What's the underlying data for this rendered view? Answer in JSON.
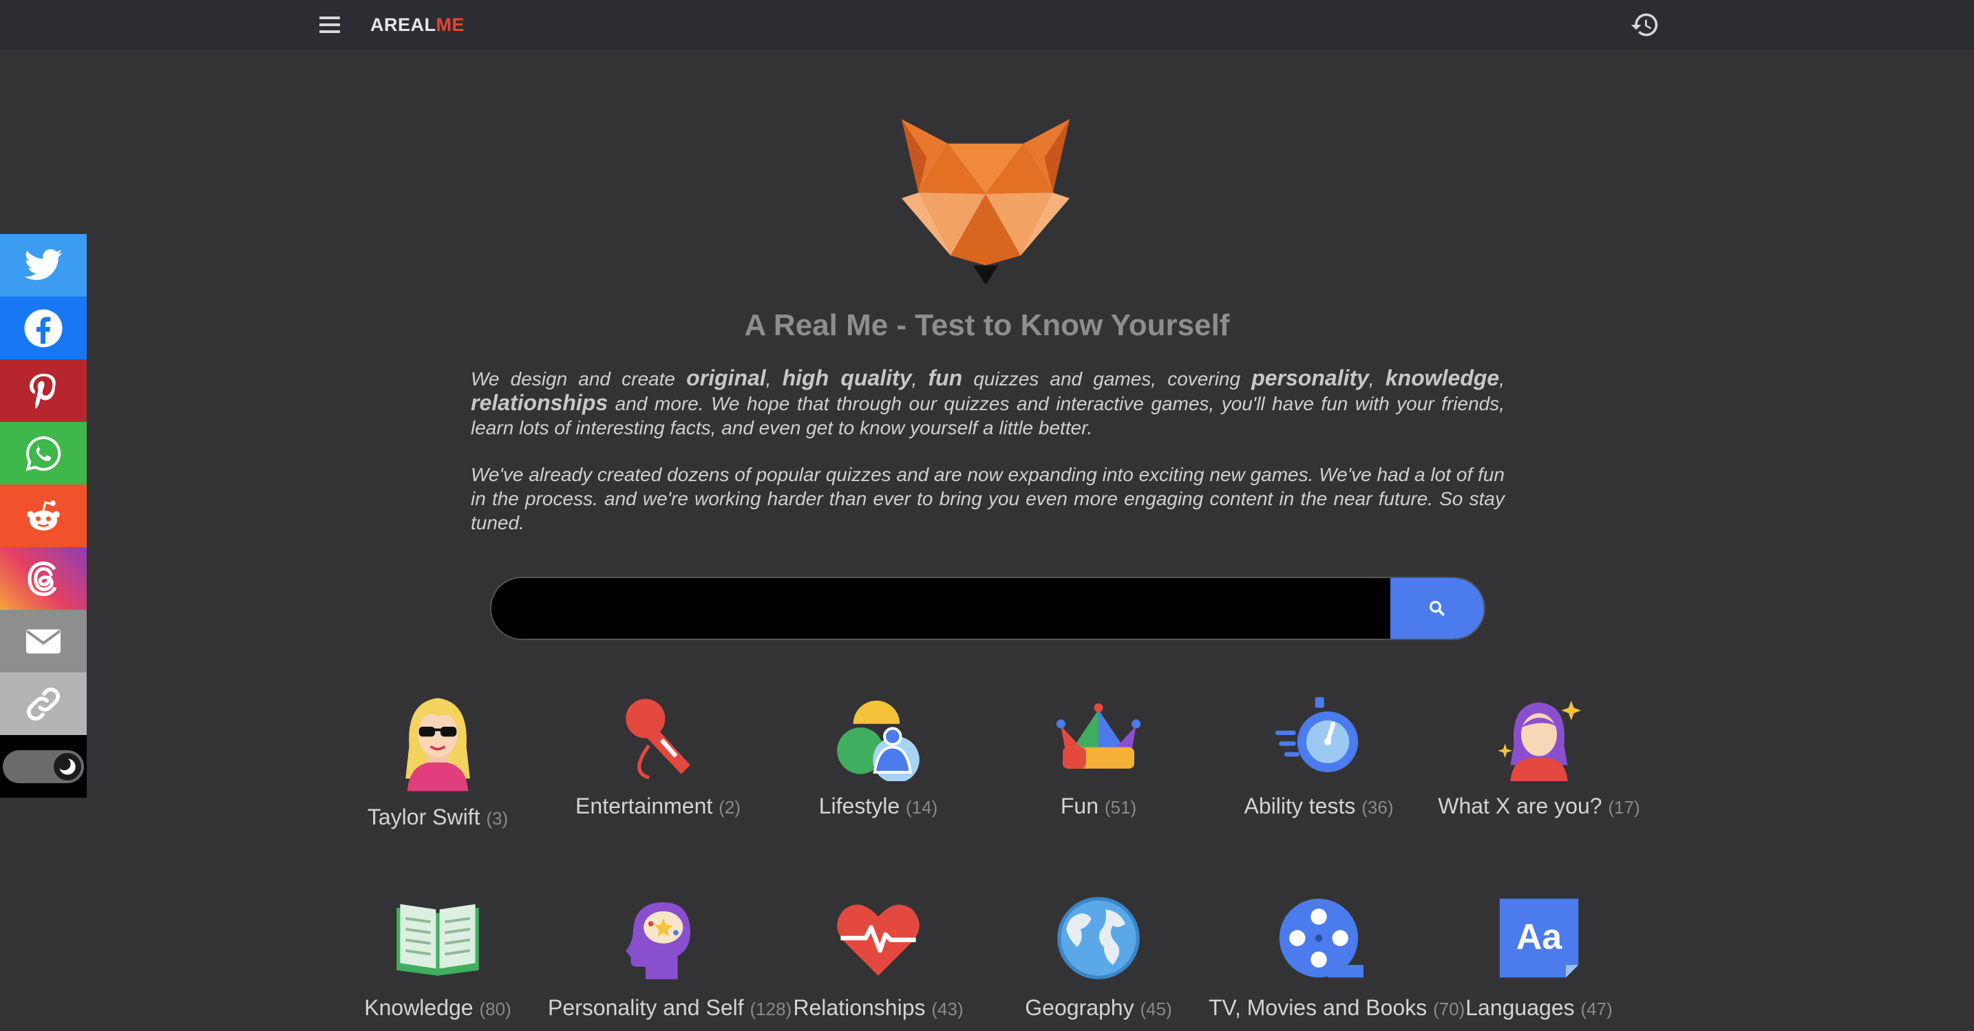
{
  "header": {
    "brand_part1": "AREAL",
    "brand_part2": "ME"
  },
  "colors": {
    "brand_accent": "#e8452c",
    "search_button": "#4b7bec",
    "background": "#333335",
    "topbar": "#2c2d33"
  },
  "share": [
    {
      "name": "twitter",
      "color": "#3b9cf0",
      "icon": "twitter-icon"
    },
    {
      "name": "facebook",
      "color": "#1877f2",
      "icon": "facebook-icon"
    },
    {
      "name": "pinterest",
      "color": "#b7252d",
      "icon": "pinterest-icon"
    },
    {
      "name": "whatsapp",
      "color": "#3fb74b",
      "icon": "whatsapp-icon"
    },
    {
      "name": "reddit",
      "color": "#f2522b",
      "icon": "reddit-icon"
    },
    {
      "name": "threads",
      "color": "#c0387a",
      "icon": "threads-icon"
    },
    {
      "name": "email",
      "color": "#8e8e8e",
      "icon": "envelope-icon"
    },
    {
      "name": "copy-link",
      "color": "#b4b4b4",
      "icon": "link-icon"
    }
  ],
  "hero": {
    "title": "A Real Me - Test to Know Yourself",
    "p1": [
      {
        "t": "We design and create ",
        "b": false
      },
      {
        "t": "original",
        "b": true
      },
      {
        "t": ", ",
        "b": false
      },
      {
        "t": "high quality",
        "b": true
      },
      {
        "t": ", ",
        "b": false
      },
      {
        "t": "fun",
        "b": true
      },
      {
        "t": " quizzes and games, covering ",
        "b": false
      },
      {
        "t": "personality",
        "b": true
      },
      {
        "t": ", ",
        "b": false
      },
      {
        "t": "knowledge",
        "b": true
      },
      {
        "t": ", ",
        "b": false
      },
      {
        "t": "relationships",
        "b": true
      },
      {
        "t": " and more. We hope that through our quizzes and interactive games, you'll have fun with your friends, learn lots of interesting facts, and even get to know yourself a little better.",
        "b": false
      }
    ],
    "p2": "We've already created dozens of popular quizzes and are now expanding into exciting new games. We've had a lot of fun in the process. and we're working harder than ever to bring you even more engaging content in the near future. So stay tuned."
  },
  "search": {
    "value": "",
    "placeholder": ""
  },
  "categories": [
    {
      "label": "Taylor Swift",
      "count": "(3)",
      "icon": "taylor-swift-icon"
    },
    {
      "label": "Entertainment",
      "count": "(2)",
      "icon": "microphone-icon"
    },
    {
      "label": "Lifestyle",
      "count": "(14)",
      "icon": "lifestyle-icon"
    },
    {
      "label": "Fun",
      "count": "(51)",
      "icon": "jester-hat-icon"
    },
    {
      "label": "Ability tests",
      "count": "(36)",
      "icon": "stopwatch-icon"
    },
    {
      "label": "What X are you?",
      "count": "(17)",
      "icon": "sparkle-person-icon"
    },
    {
      "label": "Knowledge",
      "count": "(80)",
      "icon": "open-book-icon"
    },
    {
      "label": "Personality and Self",
      "count": "(128)",
      "icon": "brain-head-icon"
    },
    {
      "label": "Relationships",
      "count": "(43)",
      "icon": "heartbeat-icon"
    },
    {
      "label": "Geography",
      "count": "(45)",
      "icon": "globe-icon"
    },
    {
      "label": "TV, Movies and Books",
      "count": "(70)",
      "icon": "film-reel-icon"
    },
    {
      "label": "Languages",
      "count": "(47)",
      "icon": "language-icon"
    }
  ]
}
